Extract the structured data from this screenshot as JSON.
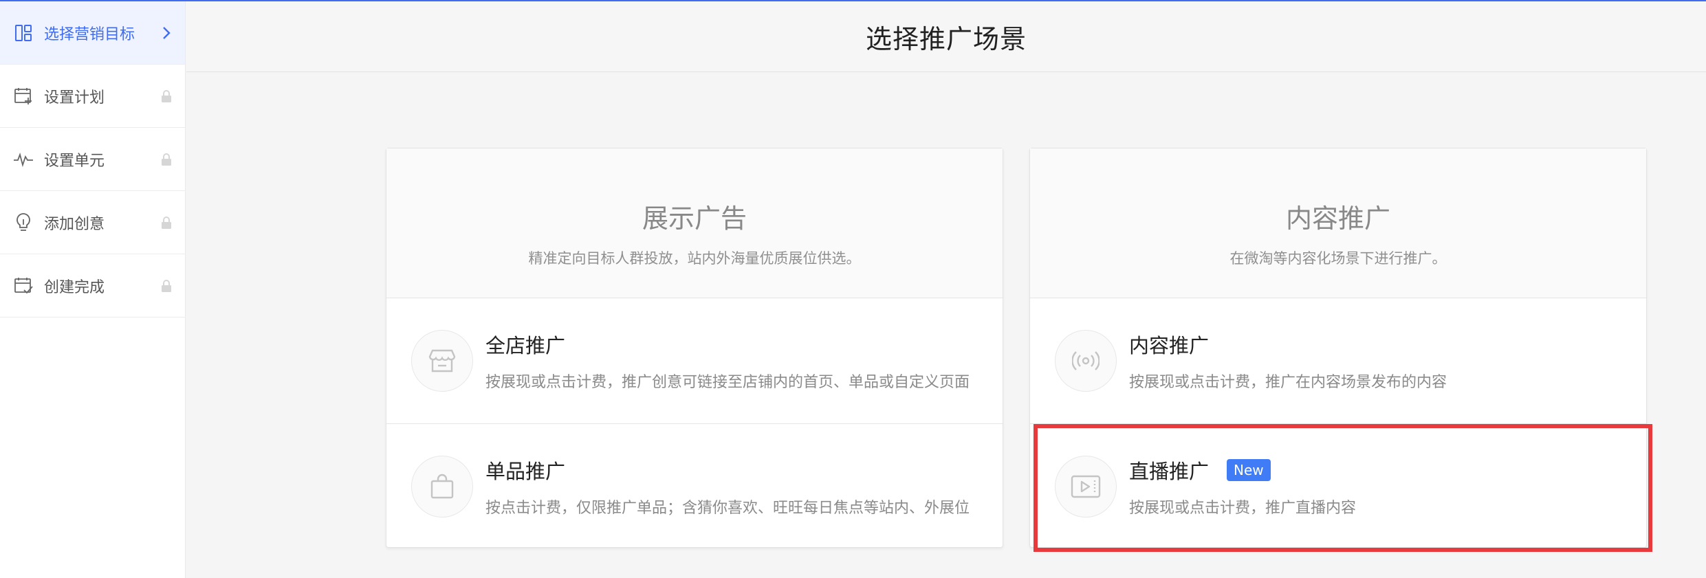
{
  "sidebar": {
    "steps": [
      {
        "label": "选择营销目标",
        "icon": "layout-icon",
        "status": "active"
      },
      {
        "label": "设置计划",
        "icon": "calendar-add-icon",
        "status": "locked"
      },
      {
        "label": "设置单元",
        "icon": "pulse-icon",
        "status": "locked"
      },
      {
        "label": "添加创意",
        "icon": "lightbulb-icon",
        "status": "locked"
      },
      {
        "label": "创建完成",
        "icon": "calendar-check-icon",
        "status": "locked"
      }
    ]
  },
  "header": {
    "title": "选择推广场景"
  },
  "cards": [
    {
      "title": "展示广告",
      "subtitle": "精准定向目标人群投放，站内外海量优质展位供选。",
      "options": [
        {
          "title": "全店推广",
          "desc": "按展现或点击计费，推广创意可链接至店铺内的首页、单品或自定义页面",
          "icon": "store-icon"
        },
        {
          "title": "单品推广",
          "desc": "按点击计费，仅限推广单品；含猜你喜欢、旺旺每日焦点等站内、外展位",
          "icon": "shopping-bag-icon"
        }
      ]
    },
    {
      "title": "内容推广",
      "subtitle": "在微淘等内容化场景下进行推广。",
      "options": [
        {
          "title": "内容推广",
          "desc": "按展现或点击计费，推广在内容场景发布的内容",
          "icon": "broadcast-icon"
        },
        {
          "title": "直播推广",
          "desc": "按展现或点击计费，推广直播内容",
          "icon": "video-play-icon",
          "badge": "New"
        }
      ]
    }
  ],
  "colors": {
    "accent": "#3f6cf0",
    "badge": "#3f7cf6",
    "highlight": "#e8393c"
  }
}
